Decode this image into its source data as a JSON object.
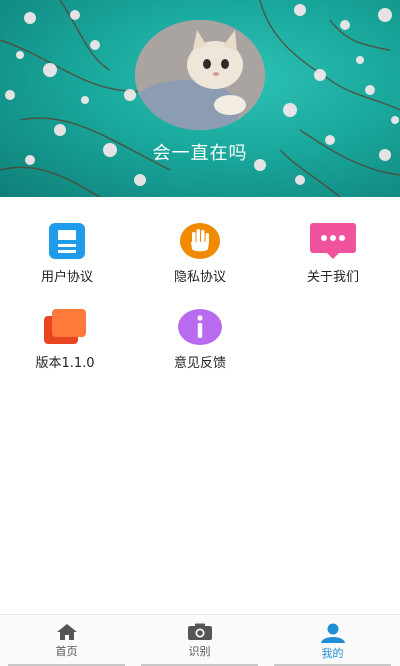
{
  "profile": {
    "username": "会一直在吗",
    "avatar_icon": "cat-avatar"
  },
  "menu": {
    "items": [
      {
        "label": "用户协议",
        "icon": "document-icon",
        "color": "#1e9be9"
      },
      {
        "label": "隐私协议",
        "icon": "hand-icon",
        "color": "#f08a00"
      },
      {
        "label": "关于我们",
        "icon": "chat-bubble-icon",
        "color": "#f0529c"
      },
      {
        "label": "版本1.1.0",
        "icon": "layers-icon",
        "color": "#f25a2a"
      },
      {
        "label": "意见反馈",
        "icon": "info-icon",
        "color": "#b96bf0"
      }
    ]
  },
  "tabbar": {
    "tabs": [
      {
        "label": "首页",
        "icon": "home-icon"
      },
      {
        "label": "识别",
        "icon": "camera-icon"
      },
      {
        "label": "我的",
        "icon": "user-icon",
        "active": true
      }
    ],
    "active_color": "#1f8fd6"
  }
}
